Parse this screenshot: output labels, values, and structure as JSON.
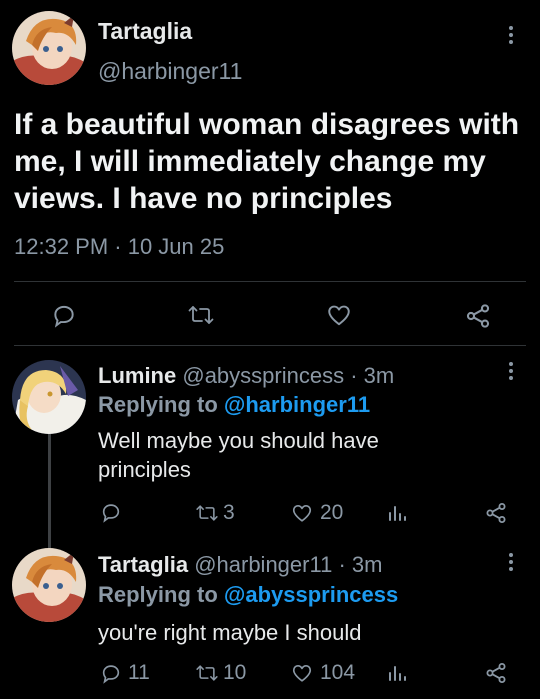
{
  "main_tweet": {
    "author_name": "Tartaglia",
    "handle": "@harbinger11",
    "text": "If a beautiful woman disagrees with me, I will immediately change my views. I have no principles",
    "timestamp": "12:32 PM · 10 Jun 25"
  },
  "replies": [
    {
      "author_name": "Lumine",
      "handle": "@abyssprincess",
      "age": "· 3m",
      "replying_label": "Replying to",
      "replying_to": "@harbinger11",
      "text": "Well maybe you should have principles",
      "reply_count": "",
      "retweet_count": "3",
      "like_count": "20"
    },
    {
      "author_name": "Tartaglia",
      "handle": "@harbinger11",
      "age": "· 3m",
      "replying_label": "Replying to",
      "replying_to": "@abyssprincess",
      "text": "you're right maybe I should",
      "reply_count": "11",
      "retweet_count": "10",
      "like_count": "104"
    }
  ],
  "icons": [
    "reply-icon",
    "retweet-icon",
    "like-icon",
    "share-icon",
    "analytics-icon",
    "more-icon"
  ],
  "colors": {
    "background": "#000000",
    "text": "#e7e9ea",
    "muted": "#8b98a5",
    "link": "#1d9bf0"
  }
}
